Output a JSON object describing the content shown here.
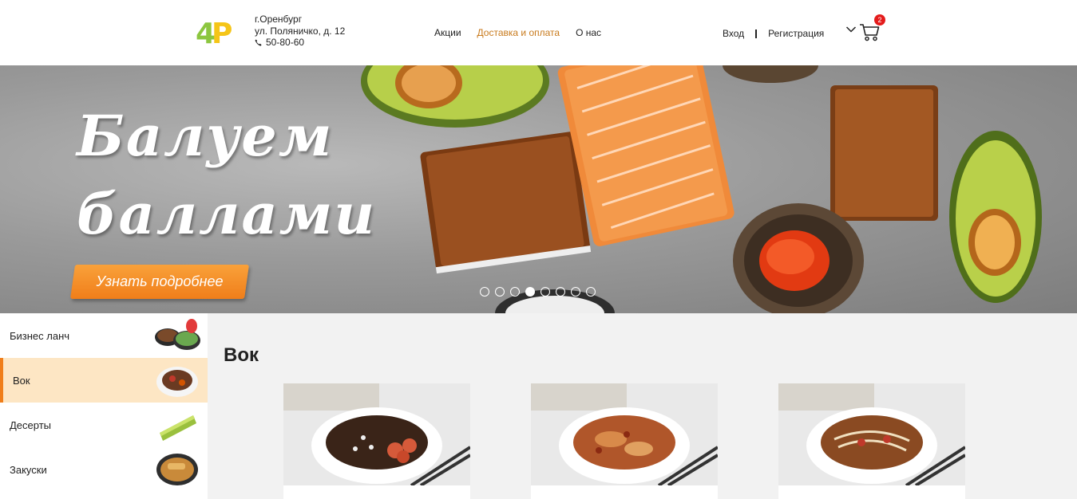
{
  "header": {
    "logo_text": "4P",
    "city": "г.Оренбург",
    "street": "ул. Поляничко, д. 12",
    "phone": "50-80-60",
    "nav": [
      {
        "label": "Акции",
        "active": false
      },
      {
        "label": "Доставка и оплата",
        "active": true
      },
      {
        "label": "О нас",
        "active": false
      }
    ],
    "login": "Вход",
    "register": "Регистрация",
    "cart_count": "2"
  },
  "banner": {
    "title_line1": "Балуем",
    "title_line2": "баллами",
    "button": "Узнать подробнее",
    "slides_total": 8,
    "active_slide": 4
  },
  "categories": [
    {
      "label": "Бизнес ланч",
      "active": false
    },
    {
      "label": "Вок",
      "active": true
    },
    {
      "label": "Десерты",
      "active": false
    },
    {
      "label": "Закуски",
      "active": false
    }
  ],
  "section": {
    "title": "Вок"
  },
  "colors": {
    "accent": "#f07e1a",
    "active_nav": "#c87a1c",
    "active_category_bg": "#fde6c4",
    "badge": "#e41c1c",
    "logo_green": "#8cc63f",
    "logo_yellow": "#f5c518"
  }
}
